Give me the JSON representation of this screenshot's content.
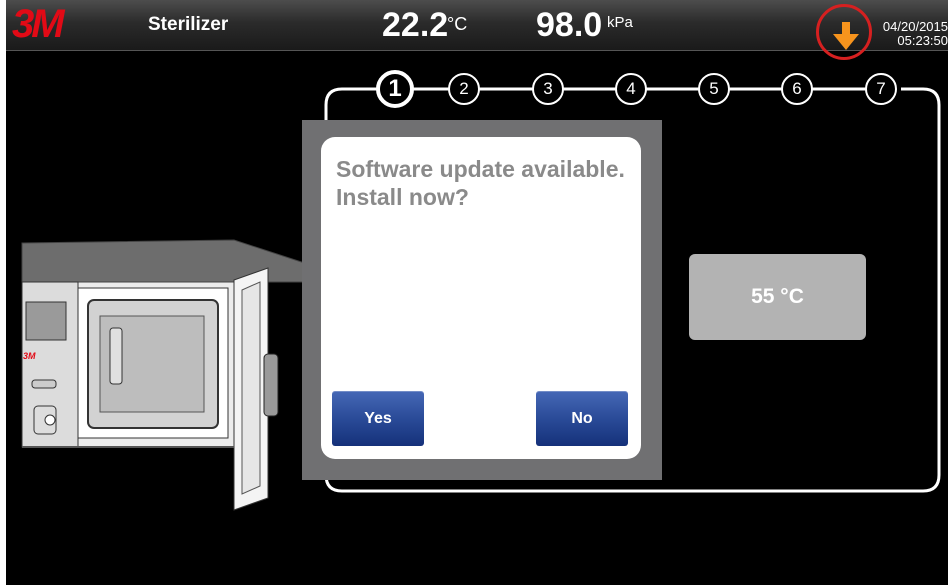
{
  "header": {
    "logo": "3M",
    "title": "Sterilizer",
    "temperature": "22.2",
    "temperature_unit": "°C",
    "pressure": "98.0",
    "pressure_unit": "kPa",
    "date": "04/20/2015",
    "time": "05:23:50",
    "update_icon": "download-arrow-icon",
    "update_icon_color": "#f7941d"
  },
  "steps": {
    "items": [
      "1",
      "2",
      "3",
      "4",
      "5",
      "6",
      "7"
    ],
    "active": "1"
  },
  "setpoint": {
    "label": "55 °C"
  },
  "oven": {
    "badge": "3M"
  },
  "dialog": {
    "message": "Software update available. Install now?",
    "yes_label": "Yes",
    "no_label": "No"
  }
}
